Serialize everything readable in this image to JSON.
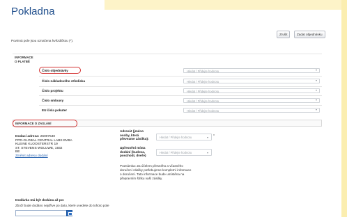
{
  "page": {
    "title": "Pokladna"
  },
  "form": {
    "required_note": "Povinná pole jsou označena hvězdičkou (*)."
  },
  "toolbar": {
    "cancel_label": "Zrušit",
    "place_order_label": "Zadat objednávku"
  },
  "billing": {
    "section_title_line1": "INFORMACE",
    "section_title_line2": "O PLATBĚ",
    "rows": [
      {
        "label": "Číslo objednávky",
        "placeholder": "Hledat / Přidejte hodnotu"
      },
      {
        "label": "Číslo nákladového střediska",
        "placeholder": "Hledat / Přidejte hodnotu"
      },
      {
        "label": "Číslo projektu",
        "placeholder": "Hledat / Přidejte hodnotu"
      },
      {
        "label": "Číslo smlouvy",
        "placeholder": "Hledat / Přidejte hodnotu"
      },
      {
        "label": "EU čísla pokuter",
        "placeholder": "Hledat / Přidejte hodnotu"
      }
    ]
  },
  "shipping": {
    "section_title": "INFORMACE O ZASLÁNÍ",
    "address_label": "Dodací adresa:",
    "address_number": "26007540",
    "address_lines": [
      "PPD-GLOBAL CENTRAL LABS BVBA",
      "KLEINE KLOOSTERSTR 19",
      "ST. STEVENS WOLUWE, 1932",
      "BE"
    ],
    "change_address_link": "Změnit adresu dodání",
    "recipient_label_lines": [
      "Adresát (jméno",
      "osoby, která",
      "převezme zásilku):"
    ],
    "recipient_placeholder": "Hledat / Přidejte hodnotu",
    "location_label_lines": [
      "Upřesnění místa",
      "dodání (budova,",
      "poschodí, dveře)"
    ],
    "location_placeholder": "Hledat / Přidejte hodnotu",
    "required_star": "*",
    "note_lines": [
      "Poznámka: Za účelem přesného a včasného",
      "doručení zásilky potřebujeme kompletní informace",
      "o doručení. Tato informace bude umístěna na",
      "přepravním štítku vaší zásilky."
    ]
  },
  "delivery": {
    "title": "Dodávka má být dodána až po:",
    "subtitle": "Zboží bude dodáno nejdříve po datu, které uvedete do tohoto pole"
  },
  "colors": {
    "accent": "#1f4e8c",
    "highlight": "#d32f2f",
    "band": "#fdf3c8"
  }
}
